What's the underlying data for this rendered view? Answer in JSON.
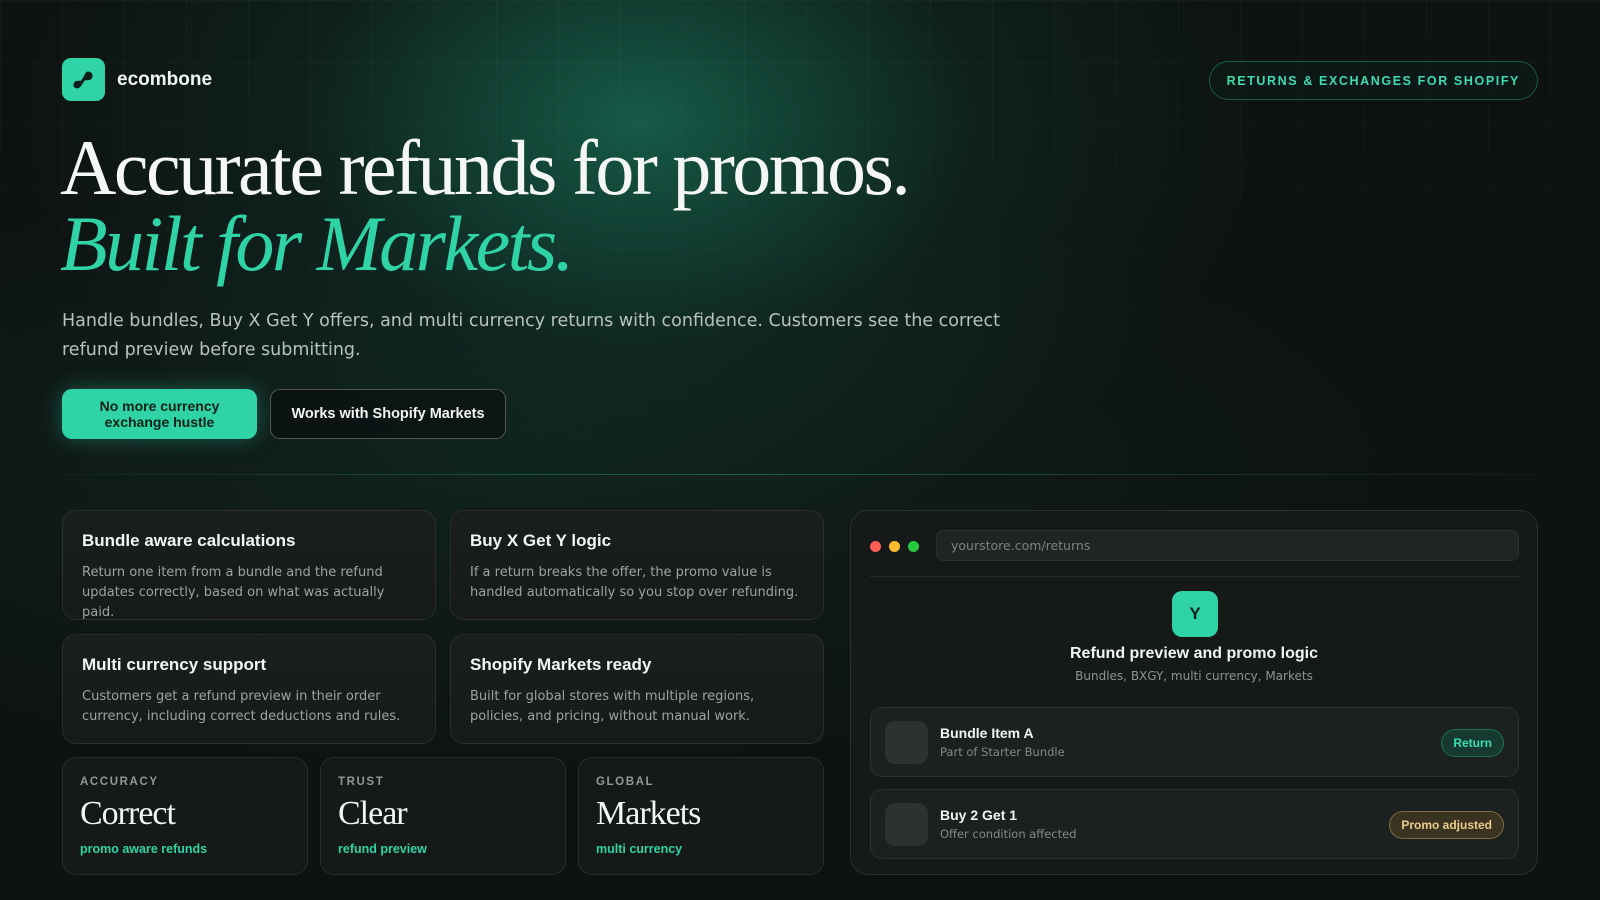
{
  "brand": {
    "name": "ecombone",
    "logo_icon": "link-icon",
    "accent_color": "#2fd3a5"
  },
  "header": {
    "pill_label": "RETURNS & EXCHANGES FOR SHOPIFY"
  },
  "hero": {
    "title_plain": "Accurate refunds for promos.",
    "title_accent": "Built for Markets.",
    "subtitle": "Handle bundles, Buy X Get Y offers, and multi currency returns with confidence. Customers see the correct refund preview before submitting.",
    "primary_button": "No more currency exchange hustle",
    "secondary_button": "Works with Shopify Markets"
  },
  "features": [
    {
      "title": "Bundle aware calculations",
      "body": "Return one item from a bundle and the refund updates correctly, based on what was actually paid."
    },
    {
      "title": "Buy X Get Y logic",
      "body": "If a return breaks the offer, the promo value is handled automatically so you stop over refunding."
    },
    {
      "title": "Multi currency support",
      "body": "Customers get a refund preview in their order currency, including correct deductions and rules."
    },
    {
      "title": "Shopify Markets ready",
      "body": "Built for global stores with multiple regions, policies, and pricing, without manual work."
    }
  ],
  "stats": [
    {
      "kicker": "ACCURACY",
      "value": "Correct",
      "foot": "promo aware refunds"
    },
    {
      "kicker": "TRUST",
      "value": "Clear",
      "foot": "refund preview"
    },
    {
      "kicker": "GLOBAL",
      "value": "Markets",
      "foot": "multi currency"
    }
  ],
  "preview": {
    "window_dots": [
      "#ff5f57",
      "#febc2e",
      "#28c840"
    ],
    "url": "yourstore.com/returns",
    "badge_letter": "Y",
    "title": "Refund preview and promo logic",
    "subtitle": "Bundles, BXGY, multi currency, Markets",
    "items": [
      {
        "name": "Bundle Item A",
        "meta": "Part of Starter Bundle",
        "action": "Return"
      },
      {
        "name": "Buy 2 Get 1",
        "meta": "Offer condition affected",
        "action": "Promo adjusted"
      }
    ]
  }
}
